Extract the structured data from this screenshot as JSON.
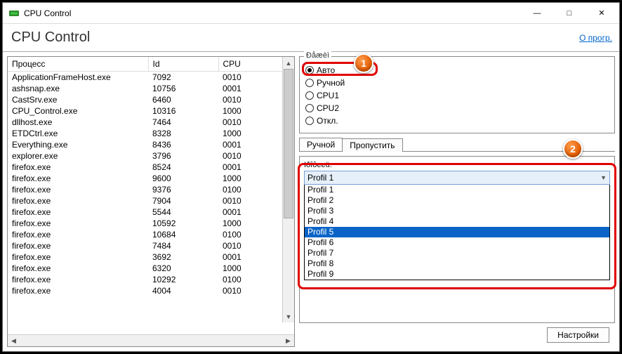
{
  "window": {
    "title": "CPU Control"
  },
  "header": {
    "title": "CPU Control",
    "about_link": "О прогр."
  },
  "table": {
    "headers": {
      "process": "Процесс",
      "id": "Id",
      "cpu": "CPU"
    },
    "rows": [
      {
        "process": "ApplicationFrameHost.exe",
        "id": "7092",
        "cpu": "0010"
      },
      {
        "process": "ashsnap.exe",
        "id": "10756",
        "cpu": "0001"
      },
      {
        "process": "CastSrv.exe",
        "id": "6460",
        "cpu": "0010"
      },
      {
        "process": "CPU_Control.exe",
        "id": "10316",
        "cpu": "1000"
      },
      {
        "process": "dllhost.exe",
        "id": "7464",
        "cpu": "0010"
      },
      {
        "process": "ETDCtrl.exe",
        "id": "8328",
        "cpu": "1000"
      },
      {
        "process": "Everything.exe",
        "id": "8436",
        "cpu": "0001"
      },
      {
        "process": "explorer.exe",
        "id": "3796",
        "cpu": "0010"
      },
      {
        "process": "firefox.exe",
        "id": "8524",
        "cpu": "0001"
      },
      {
        "process": "firefox.exe",
        "id": "9600",
        "cpu": "1000"
      },
      {
        "process": "firefox.exe",
        "id": "9376",
        "cpu": "0100"
      },
      {
        "process": "firefox.exe",
        "id": "7904",
        "cpu": "0010"
      },
      {
        "process": "firefox.exe",
        "id": "5544",
        "cpu": "0001"
      },
      {
        "process": "firefox.exe",
        "id": "10592",
        "cpu": "1000"
      },
      {
        "process": "firefox.exe",
        "id": "10684",
        "cpu": "0100"
      },
      {
        "process": "firefox.exe",
        "id": "7484",
        "cpu": "0010"
      },
      {
        "process": "firefox.exe",
        "id": "3692",
        "cpu": "0001"
      },
      {
        "process": "firefox.exe",
        "id": "6320",
        "cpu": "1000"
      },
      {
        "process": "firefox.exe",
        "id": "10292",
        "cpu": "0100"
      },
      {
        "process": "firefox.exe",
        "id": "4004",
        "cpu": "0010"
      }
    ]
  },
  "modes": {
    "legend": "Ðåæèì",
    "options": [
      {
        "label": "Авто",
        "checked": true
      },
      {
        "label": "Ручной",
        "checked": false
      },
      {
        "label": "CPU1",
        "checked": false
      },
      {
        "label": "CPU2",
        "checked": false
      },
      {
        "label": "Откл.",
        "checked": false
      }
    ]
  },
  "tabs": {
    "manual": "Ручной",
    "skip": "Пропустить"
  },
  "profile": {
    "label": "Iðîôeeü:",
    "selected": "Profil 1",
    "highlighted": "Profil 5",
    "options": [
      "Profil 1",
      "Profil 2",
      "Profil 3",
      "Profil 4",
      "Profil 5",
      "Profil 6",
      "Profil 7",
      "Profil 8",
      "Profil 9"
    ]
  },
  "footer": {
    "settings": "Настройки"
  },
  "annotations": {
    "badge1": "1",
    "badge2": "2"
  }
}
